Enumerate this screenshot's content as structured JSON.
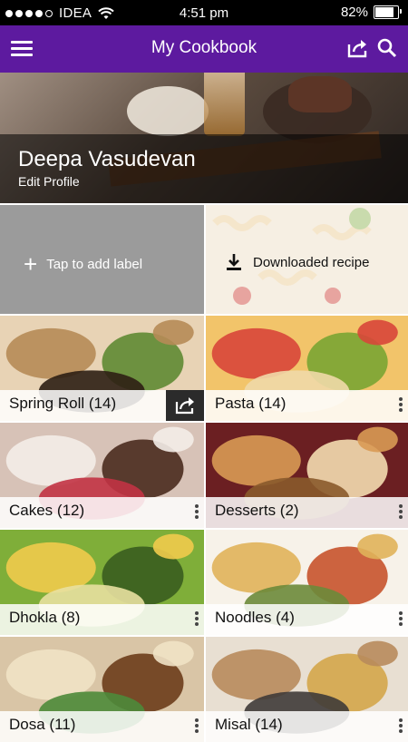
{
  "status_bar": {
    "carrier": "IDEA",
    "time": "4:51 pm",
    "battery": "82%",
    "battery_level": 0.82,
    "signal_bars": 4
  },
  "app_bar": {
    "title": "My Cookbook",
    "icons": [
      "menu-icon",
      "share-icon",
      "search-icon"
    ]
  },
  "profile": {
    "name": "Deepa Vasudevan",
    "edit_label": "Edit Profile"
  },
  "actions": {
    "add_label": "Tap to add label",
    "downloaded": "Downloaded recipe"
  },
  "categories": [
    {
      "label": "Spring Roll (14)",
      "icon": "share-icon"
    },
    {
      "label": "Pasta (14)",
      "icon": "more-vert-icon"
    },
    {
      "label": "Cakes (12)",
      "icon": "more-vert-icon"
    },
    {
      "label": "Desserts (2)",
      "icon": "more-vert-icon"
    },
    {
      "label": "Dhokla (8)",
      "icon": "more-vert-icon"
    },
    {
      "label": "Noodles (4)",
      "icon": "more-vert-icon"
    },
    {
      "label": "Dosa (11)",
      "icon": "more-vert-icon"
    },
    {
      "label": "Misal (14)",
      "icon": "more-vert-icon"
    }
  ],
  "colors": {
    "app_bar": "#5d1a9f",
    "add_label_tile": "#9b9b9b"
  }
}
